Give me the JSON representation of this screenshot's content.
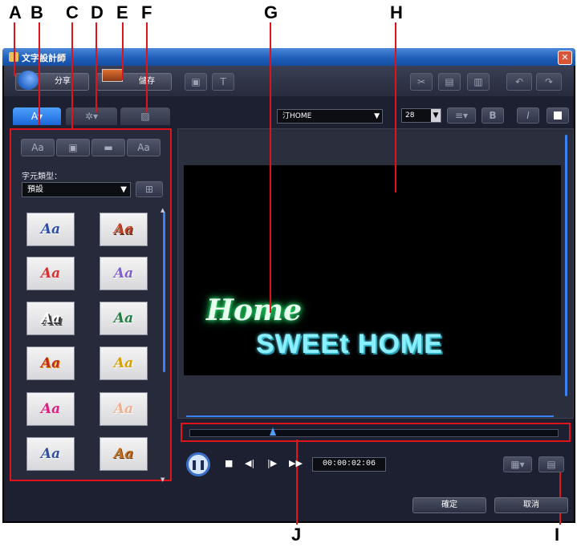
{
  "callouts": [
    "A",
    "B",
    "C",
    "D",
    "E",
    "F",
    "G",
    "H",
    "I",
    "J"
  ],
  "window": {
    "title": "文字設計師"
  },
  "toolbar": {
    "share_label": "分享",
    "save_label": "儲存"
  },
  "font_panel": {
    "preset_label": "字元類型：",
    "preset_value": "預設",
    "style_buttons": [
      "Aa",
      "Aa"
    ],
    "thumb_text": "Aa"
  },
  "font_controls": {
    "font_name": "汀HOME",
    "font_size": "28"
  },
  "format_buttons": {
    "bold": "B",
    "italic": "I"
  },
  "preview": {
    "line1": "Home",
    "line2": "SWEEt HOME"
  },
  "playback": {
    "timecode": "00:00:02:06"
  },
  "footer": {
    "ok_label": "確定",
    "cancel_label": "取消"
  },
  "colors": {
    "accent": "#e0121a",
    "window_bg": "#1d2030",
    "titlebar": "#1d5cb8"
  }
}
